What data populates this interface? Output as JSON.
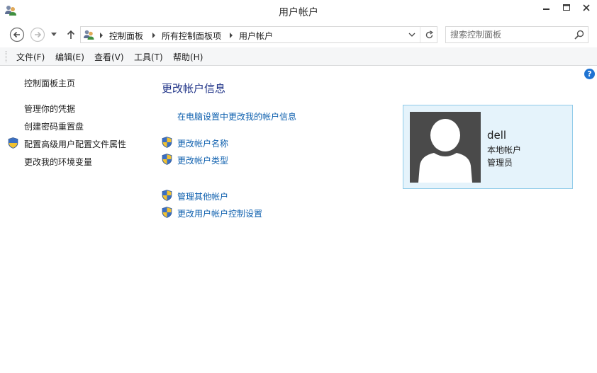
{
  "window": {
    "title": "用户帐户"
  },
  "address": {
    "crumbs": [
      "控制面板",
      "所有控制面板项",
      "用户帐户"
    ]
  },
  "search": {
    "placeholder": "搜索控制面板"
  },
  "menu": {
    "items": [
      "文件(F)",
      "编辑(E)",
      "查看(V)",
      "工具(T)",
      "帮助(H)"
    ]
  },
  "help": {
    "glyph": "?"
  },
  "left_pane": {
    "home": "控制面板主页",
    "links": [
      "管理你的凭据",
      "创建密码重置盘",
      "配置高级用户配置文件属性",
      "更改我的环境变量"
    ]
  },
  "main": {
    "title": "更改帐户信息",
    "pc_settings_link": "在电脑设置中更改我的帐户信息",
    "tasks": [
      "更改帐户名称",
      "更改帐户类型",
      "管理其他帐户",
      "更改用户帐户控制设置"
    ]
  },
  "account": {
    "name": "dell",
    "type": "本地帐户",
    "role": "管理员"
  },
  "colors": {
    "link": "#0d5fae",
    "title": "#1e3287",
    "card_bg": "#e5f3fb",
    "card_border": "#8fcbe9",
    "avatar_bg": "#4a4a4a"
  }
}
